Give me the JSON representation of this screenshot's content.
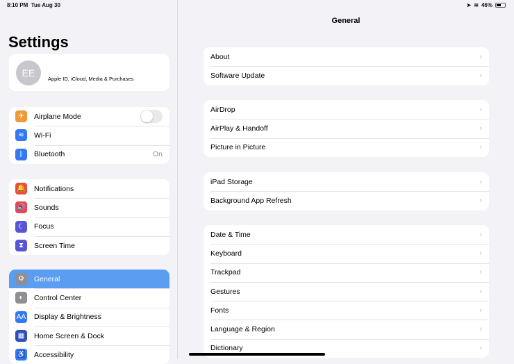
{
  "status": {
    "time": "8:10 PM",
    "date": "Tue Aug 30",
    "battery": "46%"
  },
  "sidebar": {
    "title": "Settings",
    "profile": {
      "initials": "EE",
      "subtitle": "Apple ID, iCloud, Media & Purchases"
    },
    "groups": [
      [
        {
          "label": "Airplane Mode",
          "icon": "airplane-icon",
          "color": "#f09a37",
          "glyph": "✈",
          "toggle": false
        },
        {
          "label": "Wi-Fi",
          "icon": "wifi-icon",
          "color": "#3478f6",
          "glyph": "≋"
        },
        {
          "label": "Bluetooth",
          "icon": "bluetooth-icon",
          "color": "#3478f6",
          "glyph": "ᛒ",
          "value": "On"
        }
      ],
      [
        {
          "label": "Notifications",
          "icon": "notifications-icon",
          "color": "#eb4d3d",
          "glyph": "🔔"
        },
        {
          "label": "Sounds",
          "icon": "sounds-icon",
          "color": "#e9445a",
          "glyph": "🔊"
        },
        {
          "label": "Focus",
          "icon": "focus-icon",
          "color": "#5856d6",
          "glyph": "☾"
        },
        {
          "label": "Screen Time",
          "icon": "hourglass-icon",
          "color": "#5856d6",
          "glyph": "⧗"
        }
      ],
      [
        {
          "label": "General",
          "icon": "gear-icon",
          "color": "#8e8e93",
          "glyph": "⚙",
          "selected": true
        },
        {
          "label": "Control Center",
          "icon": "control-center-icon",
          "color": "#8e8e93",
          "glyph": "◐"
        },
        {
          "label": "Display & Brightness",
          "icon": "display-icon",
          "color": "#3478f6",
          "glyph": "AA"
        },
        {
          "label": "Home Screen & Dock",
          "icon": "home-screen-icon",
          "color": "#2f4fbf",
          "glyph": "▦"
        },
        {
          "label": "Accessibility",
          "icon": "accessibility-icon",
          "color": "#3478f6",
          "glyph": "♿"
        }
      ]
    ]
  },
  "main": {
    "title": "General",
    "groups": [
      [
        "About",
        "Software Update"
      ],
      [
        "AirDrop",
        "AirPlay & Handoff",
        "Picture in Picture"
      ],
      [
        "iPad Storage",
        "Background App Refresh"
      ],
      [
        "Date & Time",
        "Keyboard",
        "Trackpad",
        "Gestures",
        "Fonts",
        "Language & Region",
        "Dictionary"
      ]
    ],
    "chevron": "›"
  }
}
